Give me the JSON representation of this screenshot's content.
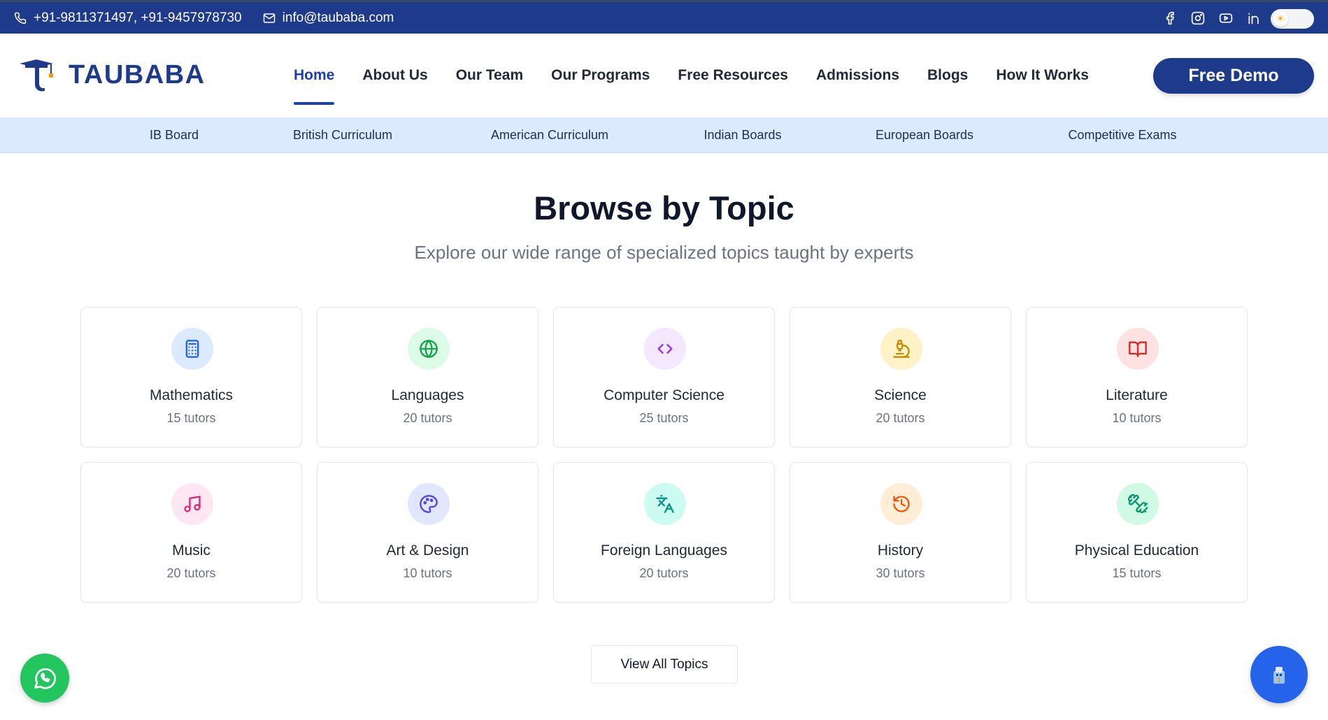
{
  "topbar": {
    "phone": "+91-9811371497, +91-9457978730",
    "email": "info@taubaba.com",
    "social": [
      "facebook-icon",
      "instagram-icon",
      "youtube-icon",
      "linkedin-icon"
    ],
    "theme_toggle_icon": "sun-icon"
  },
  "header": {
    "brand": "TAUBABA",
    "nav": [
      {
        "label": "Home",
        "active": true
      },
      {
        "label": "About Us"
      },
      {
        "label": "Our Team"
      },
      {
        "label": "Our Programs"
      },
      {
        "label": "Free Resources"
      },
      {
        "label": "Admissions"
      },
      {
        "label": "Blogs"
      },
      {
        "label": "How It Works"
      }
    ],
    "cta": "Free Demo"
  },
  "curriculum": [
    "IB Board",
    "British Curriculum",
    "American Curriculum",
    "Indian Boards",
    "European Boards",
    "Competitive Exams"
  ],
  "section": {
    "title": "Browse by Topic",
    "subtitle": "Explore our wide range of specialized topics taught by experts"
  },
  "topics": [
    {
      "name": "Mathematics",
      "count": "15 tutors",
      "icon": "calculator-icon",
      "color": "#2563eb",
      "bg": "#dbeafe"
    },
    {
      "name": "Languages",
      "count": "20 tutors",
      "icon": "globe-icon",
      "color": "#16a34a",
      "bg": "#dcfce7"
    },
    {
      "name": "Computer Science",
      "count": "25 tutors",
      "icon": "code-icon",
      "color": "#9333ea",
      "bg": "#f3e8ff"
    },
    {
      "name": "Science",
      "count": "20 tutors",
      "icon": "microscope-icon",
      "color": "#ca8a04",
      "bg": "#fef3c7"
    },
    {
      "name": "Literature",
      "count": "10 tutors",
      "icon": "book-open-icon",
      "color": "#dc2626",
      "bg": "#fee2e2"
    },
    {
      "name": "Music",
      "count": "20 tutors",
      "icon": "music-note-icon",
      "color": "#db2777",
      "bg": "#fce7f3"
    },
    {
      "name": "Art & Design",
      "count": "10 tutors",
      "icon": "palette-icon",
      "color": "#4f46e5",
      "bg": "#e0e7ff"
    },
    {
      "name": "Foreign Languages",
      "count": "20 tutors",
      "icon": "translate-icon",
      "color": "#0d9488",
      "bg": "#ccfbf1"
    },
    {
      "name": "History",
      "count": "30 tutors",
      "icon": "history-icon",
      "color": "#ea580c",
      "bg": "#ffedd5"
    },
    {
      "name": "Physical Education",
      "count": "15 tutors",
      "icon": "dumbbell-icon",
      "color": "#059669",
      "bg": "#d1fae5"
    }
  ],
  "view_all": "View All Topics",
  "floating": {
    "whatsapp_icon": "whatsapp-icon",
    "chatbot_icon": "chatbot-icon"
  }
}
